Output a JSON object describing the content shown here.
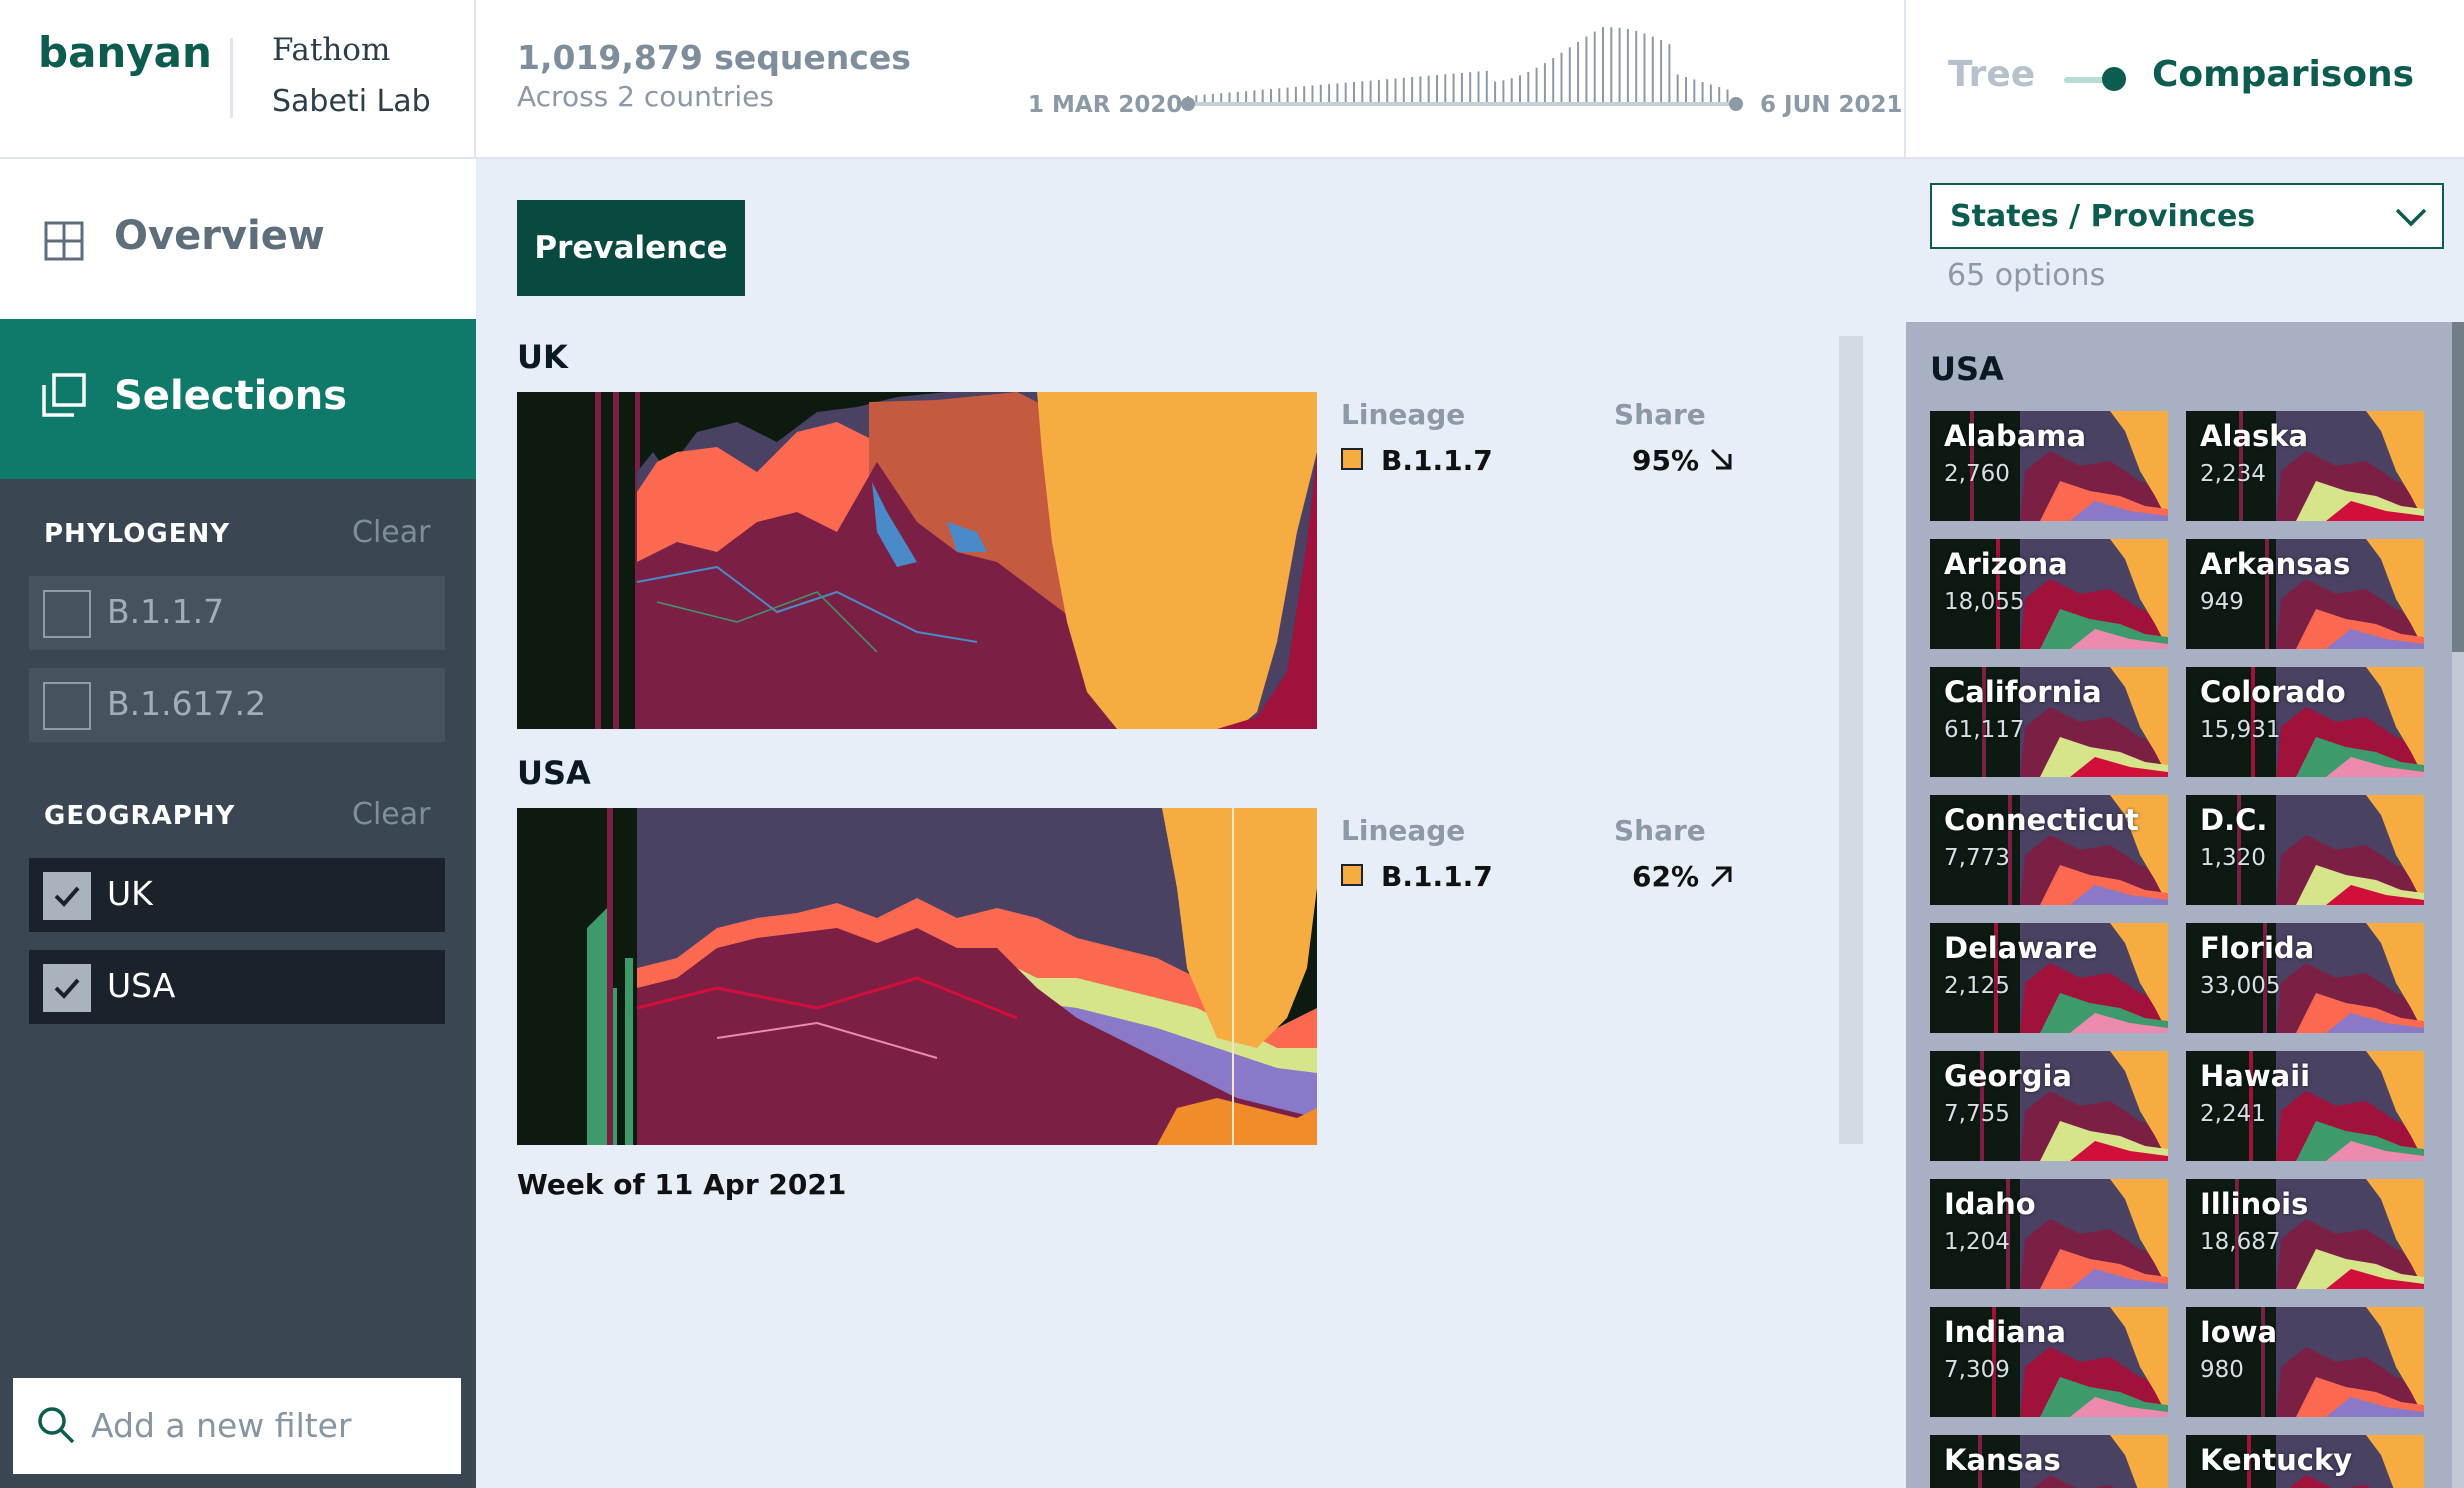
{
  "header": {
    "logo": "banyan",
    "partner_name": "Fathom",
    "lab_name": "Sabeti Lab",
    "sequence_count": "1,019,879 sequences",
    "countries_text": "Across 2 countries",
    "date_start": "1 MAR 2020",
    "date_end": "6 JUN 2021",
    "view_toggle": {
      "off_label": "Tree",
      "on_label": "Comparisons",
      "active": "Comparisons"
    }
  },
  "sidebar": {
    "nav": [
      {
        "label": "Overview",
        "icon": "grid-icon",
        "active": false
      },
      {
        "label": "Selections",
        "icon": "stack-icon",
        "active": true
      }
    ],
    "phylogeny": {
      "title": "PHYLOGENY",
      "clear_label": "Clear",
      "items": [
        {
          "label": "B.1.1.7",
          "checked": false
        },
        {
          "label": "B.1.617.2",
          "checked": false
        }
      ]
    },
    "geography": {
      "title": "GEOGRAPHY",
      "clear_label": "Clear",
      "items": [
        {
          "label": "UK",
          "checked": true
        },
        {
          "label": "USA",
          "checked": true
        }
      ]
    },
    "filter_placeholder": "Add a new filter"
  },
  "main": {
    "tab": "Prevalence",
    "countries": [
      {
        "name": "UK",
        "legend_header_lineage": "Lineage",
        "legend_header_share": "Share",
        "lineage": "B.1.1.7",
        "share": "95%",
        "trend": "down"
      },
      {
        "name": "USA",
        "legend_header_lineage": "Lineage",
        "legend_header_share": "Share",
        "lineage": "B.1.1.7",
        "share": "62%",
        "trend": "up"
      }
    ],
    "week_label": "Week of 11 Apr 2021"
  },
  "right_panel": {
    "dropdown_label": "States / Provinces",
    "options_count": "65 options",
    "group_title": "USA",
    "states": [
      {
        "name": "Alabama",
        "count": "2,760"
      },
      {
        "name": "Alaska",
        "count": "2,234"
      },
      {
        "name": "Arizona",
        "count": "18,055"
      },
      {
        "name": "Arkansas",
        "count": "949"
      },
      {
        "name": "California",
        "count": "61,117"
      },
      {
        "name": "Colorado",
        "count": "15,931"
      },
      {
        "name": "Connecticut",
        "count": "7,773"
      },
      {
        "name": "D.C.",
        "count": "1,320"
      },
      {
        "name": "Delaware",
        "count": "2,125"
      },
      {
        "name": "Florida",
        "count": "33,005"
      },
      {
        "name": "Georgia",
        "count": "7,755"
      },
      {
        "name": "Hawaii",
        "count": "2,241"
      },
      {
        "name": "Idaho",
        "count": "1,204"
      },
      {
        "name": "Illinois",
        "count": "18,687"
      },
      {
        "name": "Indiana",
        "count": "7,309"
      },
      {
        "name": "Iowa",
        "count": "980"
      },
      {
        "name": "Kansas",
        "count": ""
      },
      {
        "name": "Kentucky",
        "count": ""
      }
    ]
  },
  "colors": {
    "brand": "#0d5c50",
    "selected_nav": "#0f7a6a",
    "b117": "#f6ac40",
    "maroon": "#7c1f44",
    "purple_gray": "#4a4163",
    "salmon": "#fb6a50",
    "rust": "#c45b40",
    "blue": "#4a8ac8",
    "lime": "#d6e48a",
    "green": "#3e9a6a"
  }
}
